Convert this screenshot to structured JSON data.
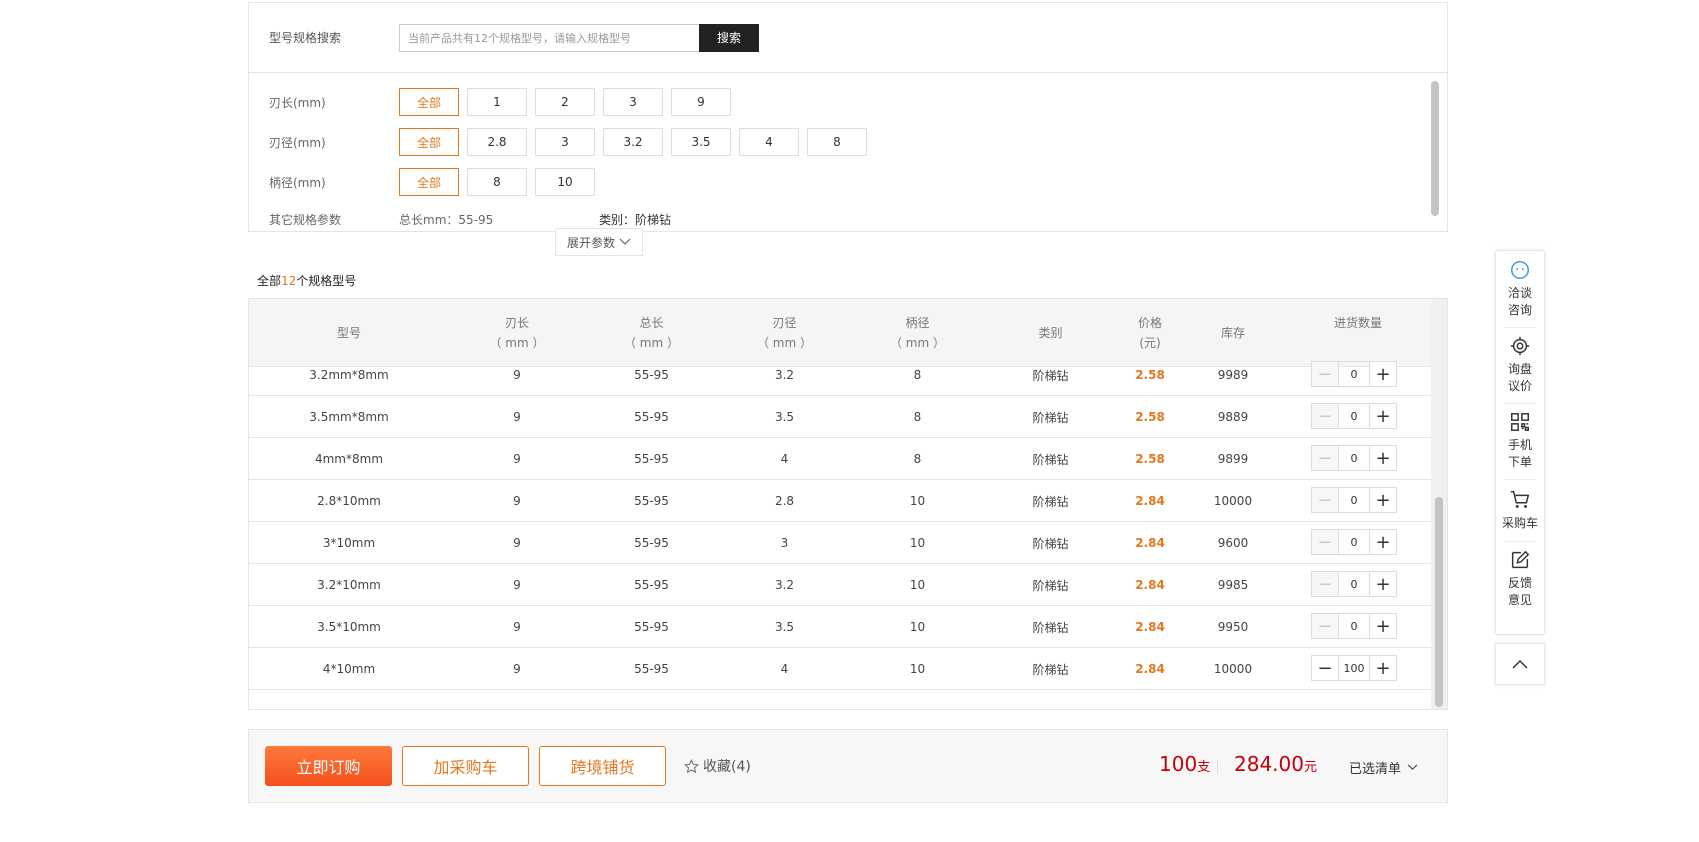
{
  "search": {
    "label": "型号规格搜索",
    "placeholder": "当前产品共有12个规格型号，请输入规格型号",
    "button": "搜索"
  },
  "filters": [
    {
      "label": "刃长(mm)",
      "options": [
        "全部",
        "1",
        "2",
        "3",
        "9"
      ],
      "selected": "全部"
    },
    {
      "label": "刃径(mm)",
      "options": [
        "全部",
        "2.8",
        "3",
        "3.2",
        "3.5",
        "4",
        "8"
      ],
      "selected": "全部"
    },
    {
      "label": "柄径(mm)",
      "options": [
        "全部",
        "8",
        "10"
      ],
      "selected": "全部"
    }
  ],
  "other_params": {
    "label": "其它规格参数",
    "total_length": "总长mm：55-95",
    "category": "类别：阶梯钻"
  },
  "expand_label": "展开参数",
  "count": {
    "prefix": "全部",
    "number": "12",
    "suffix": "个规格型号"
  },
  "table": {
    "headers": {
      "model": "型号",
      "blade_len": "刃长",
      "total_len": "总长",
      "blade_dia": "刃径",
      "shank_dia": "柄径",
      "unit": "（ mm ）",
      "category": "类别",
      "price": "价格",
      "price_unit": "(元)",
      "stock": "库存",
      "qty": "进货数量"
    },
    "rows": [
      {
        "model": "3.2mm*8mm",
        "blade_len": "9",
        "total_len": "55-95",
        "blade_dia": "3.2",
        "shank_dia": "8",
        "category": "阶梯钻",
        "price": "2.58",
        "stock": "9989",
        "qty": "0"
      },
      {
        "model": "3.5mm*8mm",
        "blade_len": "9",
        "total_len": "55-95",
        "blade_dia": "3.5",
        "shank_dia": "8",
        "category": "阶梯钻",
        "price": "2.58",
        "stock": "9889",
        "qty": "0"
      },
      {
        "model": "4mm*8mm",
        "blade_len": "9",
        "total_len": "55-95",
        "blade_dia": "4",
        "shank_dia": "8",
        "category": "阶梯钻",
        "price": "2.58",
        "stock": "9899",
        "qty": "0"
      },
      {
        "model": "2.8*10mm",
        "blade_len": "9",
        "total_len": "55-95",
        "blade_dia": "2.8",
        "shank_dia": "10",
        "category": "阶梯钻",
        "price": "2.84",
        "stock": "10000",
        "qty": "0"
      },
      {
        "model": "3*10mm",
        "blade_len": "9",
        "total_len": "55-95",
        "blade_dia": "3",
        "shank_dia": "10",
        "category": "阶梯钻",
        "price": "2.84",
        "stock": "9600",
        "qty": "0"
      },
      {
        "model": "3.2*10mm",
        "blade_len": "9",
        "total_len": "55-95",
        "blade_dia": "3.2",
        "shank_dia": "10",
        "category": "阶梯钻",
        "price": "2.84",
        "stock": "9985",
        "qty": "0"
      },
      {
        "model": "3.5*10mm",
        "blade_len": "9",
        "total_len": "55-95",
        "blade_dia": "3.5",
        "shank_dia": "10",
        "category": "阶梯钻",
        "price": "2.84",
        "stock": "9950",
        "qty": "0"
      },
      {
        "model": "4*10mm",
        "blade_len": "9",
        "total_len": "55-95",
        "blade_dia": "4",
        "shank_dia": "10",
        "category": "阶梯钻",
        "price": "2.84",
        "stock": "10000",
        "qty": "100"
      }
    ]
  },
  "actions": {
    "buy_now": "立即订购",
    "add_cart": "加采购车",
    "cross_border": "跨境铺货",
    "favorite": "收藏(4)"
  },
  "summary": {
    "quantity": "100",
    "quantity_unit": "支",
    "amount": "284.00",
    "amount_unit": "元",
    "picked": "已选清单"
  },
  "sidebar": {
    "items": [
      {
        "label1": "洽谈",
        "label2": "咨询",
        "icon": "chat-icon"
      },
      {
        "label1": "询盘",
        "label2": "议价",
        "icon": "target-icon"
      },
      {
        "label1": "手机",
        "label2": "下单",
        "icon": "qrcode-icon"
      },
      {
        "label1": "采购车",
        "label2": "",
        "icon": "cart-icon"
      },
      {
        "label1": "反馈",
        "label2": "意见",
        "icon": "edit-icon"
      }
    ]
  },
  "colors": {
    "accent": "#e2781f",
    "total": "#c3000b",
    "buy_button": "#f2501a"
  }
}
